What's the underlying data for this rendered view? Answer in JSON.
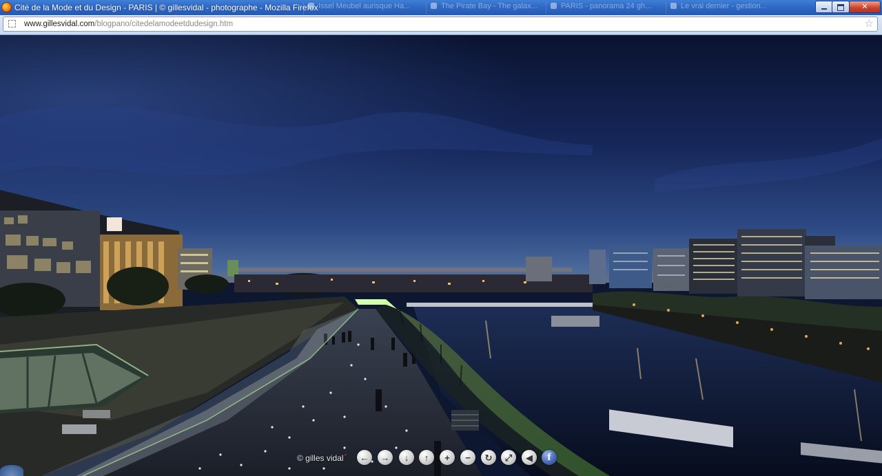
{
  "window": {
    "title": "Cité de la Mode et du Design - PARIS | © gillesvidal - photographe - Mozilla Firefox",
    "background_tabs": [
      "Issel Meubel aurisque Ha...",
      "The Pirate Bay - The galax...",
      "PARIS - panorama 24 gh...",
      "Le vrai dernier - gestion..."
    ]
  },
  "browser": {
    "url_host": "www.gillesvidal.com",
    "url_path": "/blogpano/citedelamodeetdudesign.htm"
  },
  "pano_controls": {
    "copyright": "© gilles vidal",
    "buttons": [
      {
        "name": "pan-left-button",
        "glyph": "←"
      },
      {
        "name": "pan-right-button",
        "glyph": "→"
      },
      {
        "name": "pan-down-button",
        "glyph": "↓"
      },
      {
        "name": "pan-up-button",
        "glyph": "↑"
      },
      {
        "name": "zoom-in-button",
        "glyph": "+"
      },
      {
        "name": "zoom-out-button",
        "glyph": "−"
      },
      {
        "name": "autorotate-button",
        "glyph": "↻"
      },
      {
        "name": "fullscreen-button",
        "glyph": "⤢"
      },
      {
        "name": "sound-button",
        "glyph": "◀"
      },
      {
        "name": "facebook-button",
        "glyph": "f"
      }
    ]
  },
  "colors": {
    "titlebar": "#2f69c5",
    "sky_top": "#0b1430",
    "sky_horizon": "#3d5f96",
    "walkway_glow": "#9cf27a",
    "river": "#0f1f3c"
  }
}
